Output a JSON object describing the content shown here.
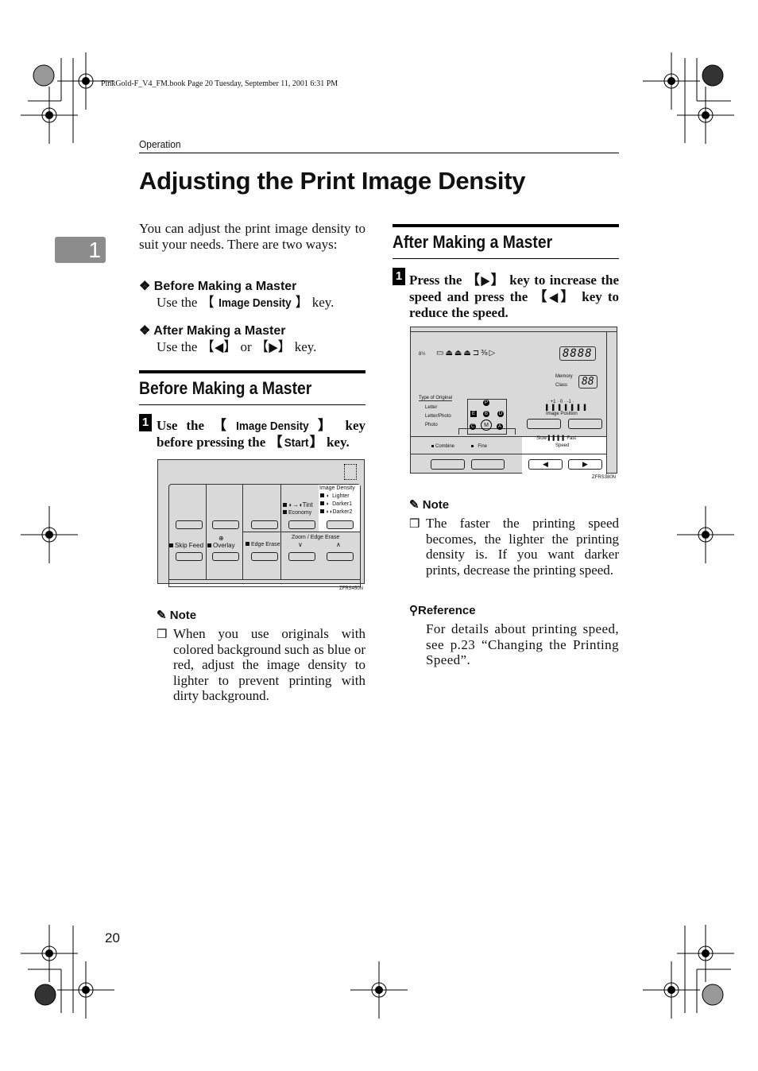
{
  "file_header": "PinkGold-F_V4_FM.book  Page 20  Tuesday, September 11, 2001  6:31 PM",
  "running_head": "Operation",
  "title": "Adjusting the Print Image Density",
  "chapter_tab": "1",
  "intro": "You can adjust the print image density to suit your needs. There are two ways:",
  "ways": [
    {
      "heading": "Before Making a Master",
      "pre": "Use the ",
      "key": "Image Density",
      "post": " key.",
      "key2": "",
      "mid": ""
    },
    {
      "heading": "After Making a Master",
      "pre": "Use the ",
      "key": "◀",
      "mid": " or ",
      "key2": "▶",
      "post": " key."
    }
  ],
  "before": {
    "heading": "Before Making a Master",
    "step_num": "1",
    "step": {
      "pre": "Use the ",
      "key": "Image Density",
      "mid": " key before pressing the ",
      "key2": "Start",
      "post": " key."
    },
    "panel": {
      "labels": [
        "Skip Feed",
        "Overlay",
        "Edge Erase",
        "Tint",
        "Economy",
        "Image Density",
        "Lighter",
        "Darker1",
        "Darker2",
        "Zoom / Edge Erase"
      ],
      "caption": "ZFRS450N"
    },
    "note_title": "Note",
    "note": "When you use originals with colored background such as blue or red, adjust the image density to lighter to prevent printing with dirty background."
  },
  "after": {
    "heading": "After Making a Master",
    "step_num": "1",
    "step": {
      "pre": "Press the ",
      "key": "▶",
      "mid": " key to increase the speed and press the ",
      "key2": "◀",
      "post": " key to reduce the speed."
    },
    "panel": {
      "paper_size": "8½",
      "counter": "8888",
      "memory": "Memory",
      "class": "Class",
      "class_display": "88",
      "type_of_original": "Type of Original",
      "types": [
        "Letter",
        "Letter/Photo",
        "Photo"
      ],
      "modes": [
        "P",
        "E",
        "B",
        "D",
        "C",
        "M",
        "A"
      ],
      "image_position_scale": "· +1 ·  0  · -1 ·",
      "image_position": "Image Position",
      "slow": "Slow",
      "fast": "Fast",
      "speed": "Speed",
      "combine": "Combine",
      "fine": "Fine",
      "left_arrow": "◀",
      "right_arrow": "▶",
      "caption": "ZFRS380N"
    },
    "note_title": "Note",
    "note": "The faster the printing speed becomes, the lighter the printing density is. If you want darker prints, decrease the printing speed.",
    "reference_title": "Reference",
    "reference": "For details about printing speed, see p.23 “Changing the Printing Speed”."
  },
  "page_number": "20"
}
